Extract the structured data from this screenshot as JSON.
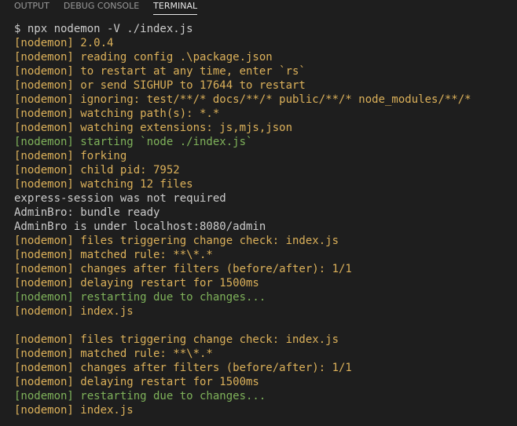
{
  "tabs": [
    {
      "label": "OUTPUT",
      "active": false
    },
    {
      "label": "DEBUG CONSOLE",
      "active": false
    },
    {
      "label": "TERMINAL",
      "active": true
    }
  ],
  "colors": {
    "background": "#1e1e1e",
    "default": "#cccccc",
    "yellow": "#dcb15a",
    "green": "#7fb25a"
  },
  "terminal": {
    "lines": [
      {
        "text": "$ npx nodemon -V ./index.js",
        "color": "default"
      },
      {
        "text": "[nodemon] 2.0.4",
        "color": "yellow"
      },
      {
        "text": "[nodemon] reading config .\\package.json",
        "color": "yellow"
      },
      {
        "text": "[nodemon] to restart at any time, enter `rs`",
        "color": "yellow"
      },
      {
        "text": "[nodemon] or send SIGHUP to 17644 to restart",
        "color": "yellow"
      },
      {
        "text": "[nodemon] ignoring: test/**/* docs/**/* public/**/* node_modules/**/*",
        "color": "yellow"
      },
      {
        "text": "[nodemon] watching path(s): *.*",
        "color": "yellow"
      },
      {
        "text": "[nodemon] watching extensions: js,mjs,json",
        "color": "yellow"
      },
      {
        "text": "[nodemon] starting `node ./index.js`",
        "color": "green"
      },
      {
        "text": "[nodemon] forking",
        "color": "yellow"
      },
      {
        "text": "[nodemon] child pid: 7952",
        "color": "yellow"
      },
      {
        "text": "[nodemon] watching 12 files",
        "color": "yellow"
      },
      {
        "text": "express-session was not required",
        "color": "default"
      },
      {
        "text": "AdminBro: bundle ready",
        "color": "default"
      },
      {
        "text": "AdminBro is under localhost:8080/admin",
        "color": "default"
      },
      {
        "text": "[nodemon] files triggering change check: index.js",
        "color": "yellow"
      },
      {
        "text": "[nodemon] matched rule: **\\*.*",
        "color": "yellow"
      },
      {
        "text": "[nodemon] changes after filters (before/after): 1/1",
        "color": "yellow"
      },
      {
        "text": "[nodemon] delaying restart for 1500ms",
        "color": "yellow"
      },
      {
        "text": "[nodemon] restarting due to changes...",
        "color": "green"
      },
      {
        "text": "[nodemon] index.js",
        "color": "yellow"
      },
      {
        "text": "",
        "color": "default"
      },
      {
        "text": "[nodemon] files triggering change check: index.js",
        "color": "yellow"
      },
      {
        "text": "[nodemon] matched rule: **\\*.*",
        "color": "yellow"
      },
      {
        "text": "[nodemon] changes after filters (before/after): 1/1",
        "color": "yellow"
      },
      {
        "text": "[nodemon] delaying restart for 1500ms",
        "color": "yellow"
      },
      {
        "text": "[nodemon] restarting due to changes...",
        "color": "green"
      },
      {
        "text": "[nodemon] index.js",
        "color": "yellow"
      }
    ]
  }
}
